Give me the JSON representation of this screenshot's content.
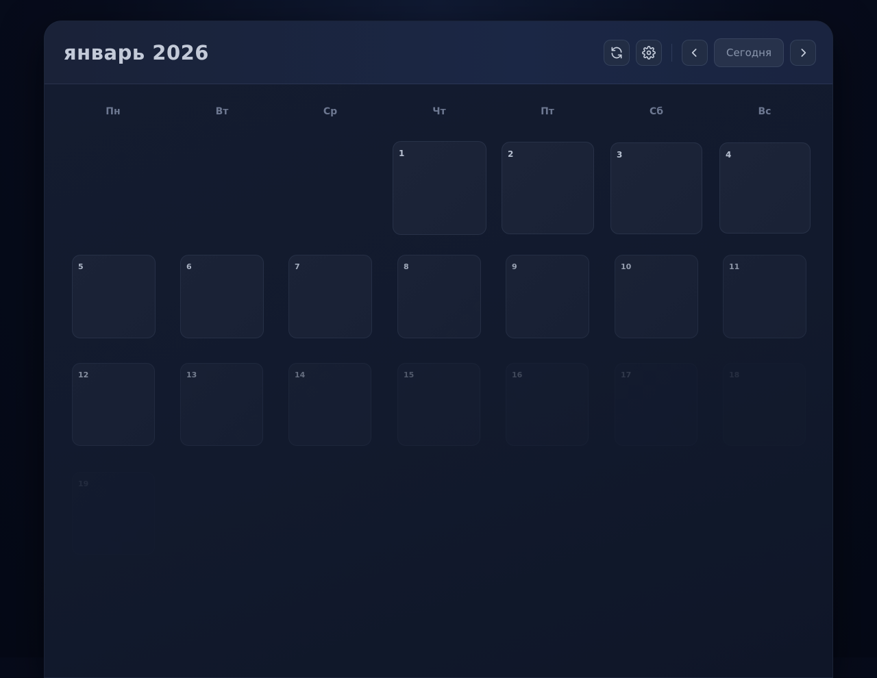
{
  "header": {
    "title": "январь 2026",
    "refresh_icon": "refresh-icon",
    "settings_icon": "gear-icon",
    "prev_icon": "chevron-left-icon",
    "next_icon": "chevron-right-icon",
    "today_label": "Сегодня"
  },
  "weekdays": [
    "Пн",
    "Вт",
    "Ср",
    "Чт",
    "Пт",
    "Сб",
    "Вс"
  ],
  "days": [
    "1",
    "2",
    "3",
    "4",
    "5",
    "6",
    "7",
    "8",
    "9",
    "10",
    "11",
    "12",
    "13",
    "14",
    "15",
    "16",
    "17",
    "18",
    "19"
  ],
  "colors": {
    "background": "#070c1c",
    "panel": "#131b2e",
    "header": "#1b2745",
    "day_cell": "#1c2438",
    "title_text": "#c3cad8"
  }
}
